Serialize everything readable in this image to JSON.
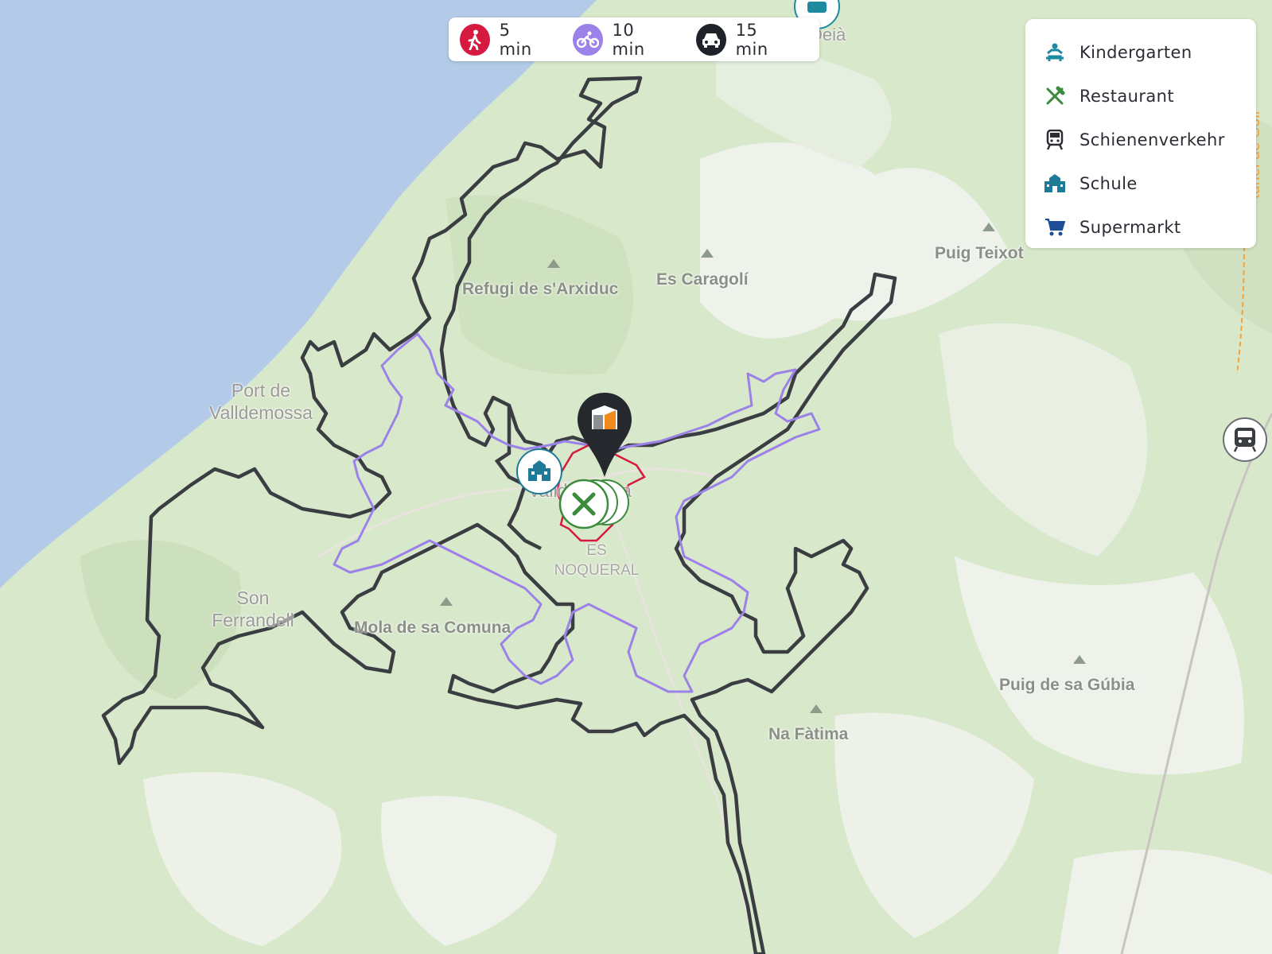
{
  "travel_modes": [
    {
      "label": "5 min",
      "icon": "walking-icon",
      "color": "#d6193f"
    },
    {
      "label": "10 min",
      "icon": "bicycle-icon",
      "color": "#9b82e8"
    },
    {
      "label": "15 min",
      "icon": "car-icon",
      "color": "#1e2329"
    }
  ],
  "legend": [
    {
      "label": "Kindergarten",
      "icon": "kindergarten-icon",
      "color": "#1e8aa0"
    },
    {
      "label": "Restaurant",
      "icon": "restaurant-icon",
      "color": "#3c8a3c"
    },
    {
      "label": "Schienenverkehr",
      "icon": "train-icon",
      "color": "#2a2d33"
    },
    {
      "label": "Schule",
      "icon": "school-icon",
      "color": "#1e7a96"
    },
    {
      "label": "Supermarkt",
      "icon": "supermarket-icon",
      "color": "#1e4c96"
    }
  ],
  "map_labels": {
    "refugi": "Refugi de s'Arxiduc",
    "caragoli": "Es Caragolí",
    "teixot": "Puig Teixot",
    "port": "Port de Valldemossa",
    "valldemossa": "Valldemossa",
    "noqueral": "ES NOQUERAL",
    "son_ferrandell": "Son Ferrandell",
    "mola": "Mola de sa Comuna",
    "gubia": "Puig de sa Gúbia",
    "fatima": "Na Fàtima",
    "tunel": "túnel de Sóll",
    "deia": "Deià"
  },
  "colors": {
    "sea": "#b4cce8",
    "land": "#d6e6c8",
    "walk_isochrone": "#d6193f",
    "bike_isochrone": "#9b82e8",
    "car_isochrone": "#3a3d42"
  }
}
